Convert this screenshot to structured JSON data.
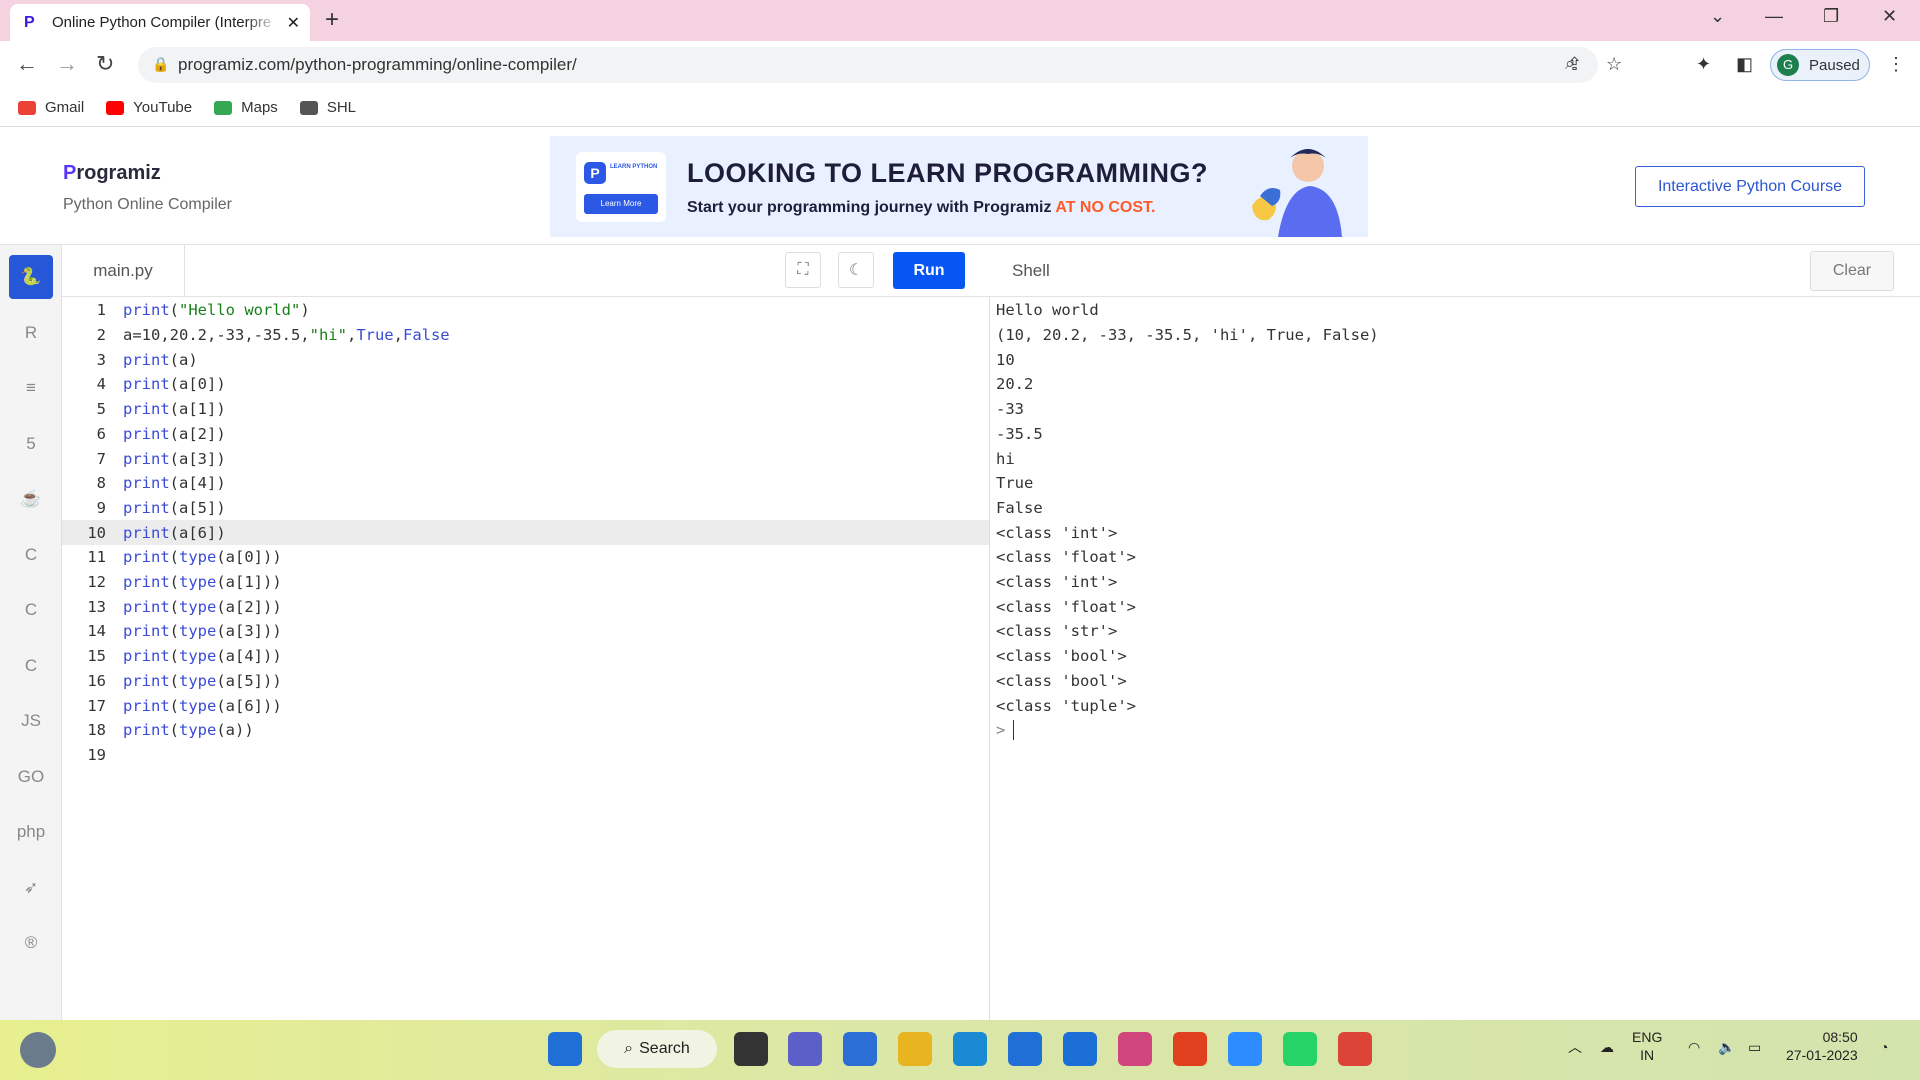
{
  "browser": {
    "tab_title": "Online Python Compiler (Interpre",
    "url": "programiz.com/python-programming/online-compiler/",
    "profile_initial": "G",
    "profile_status": "Paused",
    "bookmarks": [
      {
        "label": "Gmail",
        "icon": "gmail-icon",
        "color": "#ea4335"
      },
      {
        "label": "YouTube",
        "icon": "youtube-icon",
        "color": "#ff0000"
      },
      {
        "label": "Maps",
        "icon": "maps-icon",
        "color": "#34a853"
      },
      {
        "label": "SHL",
        "icon": "shl-icon",
        "color": "#555555"
      }
    ]
  },
  "site": {
    "logo": "rogramiz",
    "logo_p": "P",
    "subtitle": "Python Online Compiler",
    "banner_heading": "LOOKING TO LEARN PROGRAMMING?",
    "banner_sub": "Start your programming journey with Programiz ",
    "banner_highlight": "AT NO COST.",
    "banner_card_label": "LEARN PYTHON",
    "banner_card_btn": "Learn More",
    "course_button": "Interactive Python Course",
    "accent": "#2557d6"
  },
  "sidebar": {
    "languages": [
      {
        "icon": "python-icon",
        "glyph": "🐍",
        "active": true
      },
      {
        "icon": "r-icon",
        "glyph": "R",
        "active": false
      },
      {
        "icon": "sql-icon",
        "glyph": "≡",
        "active": false
      },
      {
        "icon": "html-icon",
        "glyph": "5",
        "active": false
      },
      {
        "icon": "java-icon",
        "glyph": "☕",
        "active": false
      },
      {
        "icon": "c-icon",
        "glyph": "C",
        "active": false
      },
      {
        "icon": "cpp-icon",
        "glyph": "C",
        "active": false
      },
      {
        "icon": "csharp-icon",
        "glyph": "C",
        "active": false
      },
      {
        "icon": "js-icon",
        "glyph": "JS",
        "active": false
      },
      {
        "icon": "go-icon",
        "glyph": "GO",
        "active": false
      },
      {
        "icon": "php-icon",
        "glyph": "php",
        "active": false
      },
      {
        "icon": "swift-icon",
        "glyph": "➶",
        "active": false
      },
      {
        "icon": "rust-icon",
        "glyph": "®",
        "active": false
      }
    ]
  },
  "editor": {
    "file_name": "main.py",
    "run_label": "Run",
    "current_line": 10,
    "lines": [
      {
        "n": "1",
        "code": [
          [
            "k",
            "print"
          ],
          [
            "n",
            "("
          ],
          [
            "s",
            "\"Hello world\""
          ],
          [
            "n",
            ")"
          ]
        ]
      },
      {
        "n": "2",
        "code": [
          [
            "n",
            "a=10,20.2,-33,-35.5,"
          ],
          [
            "s",
            "\"hi\""
          ],
          [
            "n",
            ","
          ],
          [
            "k",
            "True"
          ],
          [
            "n",
            ","
          ],
          [
            "k",
            "False"
          ]
        ]
      },
      {
        "n": "3",
        "code": [
          [
            "k",
            "print"
          ],
          [
            "n",
            "(a)"
          ]
        ]
      },
      {
        "n": "4",
        "code": [
          [
            "k",
            "print"
          ],
          [
            "n",
            "(a[0])"
          ]
        ]
      },
      {
        "n": "5",
        "code": [
          [
            "k",
            "print"
          ],
          [
            "n",
            "(a[1])"
          ]
        ]
      },
      {
        "n": "6",
        "code": [
          [
            "k",
            "print"
          ],
          [
            "n",
            "(a[2])"
          ]
        ]
      },
      {
        "n": "7",
        "code": [
          [
            "k",
            "print"
          ],
          [
            "n",
            "(a[3])"
          ]
        ]
      },
      {
        "n": "8",
        "code": [
          [
            "k",
            "print"
          ],
          [
            "n",
            "(a[4])"
          ]
        ]
      },
      {
        "n": "9",
        "code": [
          [
            "k",
            "print"
          ],
          [
            "n",
            "(a[5])"
          ]
        ]
      },
      {
        "n": "10",
        "code": [
          [
            "k",
            "print"
          ],
          [
            "n",
            "(a[6])"
          ]
        ]
      },
      {
        "n": "11",
        "code": [
          [
            "k",
            "print"
          ],
          [
            "n",
            "("
          ],
          [
            "k",
            "type"
          ],
          [
            "n",
            "(a[0]))"
          ]
        ]
      },
      {
        "n": "12",
        "code": [
          [
            "k",
            "print"
          ],
          [
            "n",
            "("
          ],
          [
            "k",
            "type"
          ],
          [
            "n",
            "(a[1]))"
          ]
        ]
      },
      {
        "n": "13",
        "code": [
          [
            "k",
            "print"
          ],
          [
            "n",
            "("
          ],
          [
            "k",
            "type"
          ],
          [
            "n",
            "(a[2]))"
          ]
        ]
      },
      {
        "n": "14",
        "code": [
          [
            "k",
            "print"
          ],
          [
            "n",
            "("
          ],
          [
            "k",
            "type"
          ],
          [
            "n",
            "(a[3]))"
          ]
        ]
      },
      {
        "n": "15",
        "code": [
          [
            "k",
            "print"
          ],
          [
            "n",
            "("
          ],
          [
            "k",
            "type"
          ],
          [
            "n",
            "(a[4]))"
          ]
        ]
      },
      {
        "n": "16",
        "code": [
          [
            "k",
            "print"
          ],
          [
            "n",
            "("
          ],
          [
            "k",
            "type"
          ],
          [
            "n",
            "(a[5]))"
          ]
        ]
      },
      {
        "n": "17",
        "code": [
          [
            "k",
            "print"
          ],
          [
            "n",
            "("
          ],
          [
            "k",
            "type"
          ],
          [
            "n",
            "(a[6]))"
          ]
        ]
      },
      {
        "n": "18",
        "code": [
          [
            "k",
            "print"
          ],
          [
            "n",
            "("
          ],
          [
            "k",
            "type"
          ],
          [
            "n",
            "(a))"
          ]
        ]
      },
      {
        "n": "19",
        "code": []
      }
    ]
  },
  "shell": {
    "title": "Shell",
    "clear_label": "Clear",
    "output": [
      "Hello world",
      "(10, 20.2, -33, -35.5, 'hi', True, False)",
      "10",
      "20.2",
      "-33",
      "-35.5",
      "hi",
      "True",
      "False",
      "<class 'int'>",
      "<class 'float'>",
      "<class 'int'>",
      "<class 'float'>",
      "<class 'str'>",
      "<class 'bool'>",
      "<class 'bool'>",
      "<class 'tuple'>"
    ],
    "prompt": ">"
  },
  "taskbar": {
    "search_label": "Search",
    "apps": [
      {
        "icon": "start-icon",
        "color": "#1f6fd6"
      },
      {
        "icon": "task-view-icon",
        "color": "#333333"
      },
      {
        "icon": "teams-icon",
        "color": "#5b5fc7"
      },
      {
        "icon": "store-icon",
        "color": "#2b6fd6"
      },
      {
        "icon": "file-explorer-icon",
        "color": "#e8b520"
      },
      {
        "icon": "edge-icon",
        "color": "#1a8ad3"
      },
      {
        "icon": "mail-icon",
        "color": "#1f6fd6"
      },
      {
        "icon": "l-app-icon",
        "color": "#1d6fd8"
      },
      {
        "icon": "app-square-icon",
        "color": "#d0457b"
      },
      {
        "icon": "office-icon",
        "color": "#e0401e"
      },
      {
        "icon": "zoom-icon",
        "color": "#2d8cff"
      },
      {
        "icon": "whatsapp-icon",
        "color": "#25d366"
      },
      {
        "icon": "chrome-icon",
        "color": "#db4437"
      }
    ],
    "lang_top": "ENG",
    "lang_bottom": "IN",
    "time": "08:50",
    "date": "27-01-2023"
  }
}
